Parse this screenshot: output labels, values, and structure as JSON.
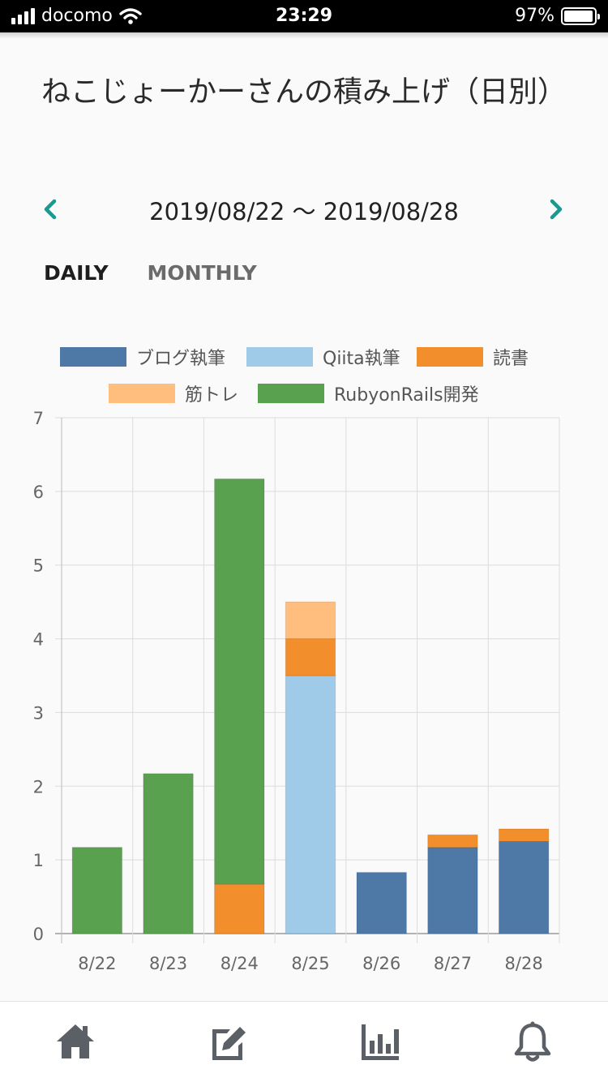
{
  "status": {
    "carrier": "docomo",
    "time": "23:29",
    "battery": "97%"
  },
  "header": {
    "title": "ねこじょーかーさんの積み上げ（日別）",
    "date_range": "2019/08/22 〜 2019/08/28"
  },
  "tabs": {
    "daily": "DAILY",
    "monthly": "MONTHLY",
    "active": "daily"
  },
  "icons": {
    "prev": "chevron-left-icon",
    "next": "chevron-right-icon",
    "home": "home-icon",
    "edit": "edit-icon",
    "stats": "bar-chart-icon",
    "notifications": "bell-icon"
  },
  "colors": {
    "accent": "#1a9a8e",
    "tabbar_icon": "#5a6066"
  },
  "chart_data": {
    "type": "bar",
    "stacked": true,
    "categories": [
      "8/22",
      "8/23",
      "8/24",
      "8/25",
      "8/26",
      "8/27",
      "8/28"
    ],
    "series": [
      {
        "name": "ブログ執筆",
        "color": "#4e79a7",
        "values": [
          0,
          0,
          0,
          0,
          0.83,
          1.17,
          1.25
        ]
      },
      {
        "name": "Qiita執筆",
        "color": "#a0cbe8",
        "values": [
          0,
          0,
          0,
          3.5,
          0,
          0,
          0
        ]
      },
      {
        "name": "読書",
        "color": "#f28e2b",
        "values": [
          0,
          0,
          0.67,
          0.5,
          0,
          0.17,
          0.17
        ]
      },
      {
        "name": "筋トレ",
        "color": "#ffbe7d",
        "values": [
          0,
          0,
          0,
          0.5,
          0,
          0,
          0
        ]
      },
      {
        "name": "RubyonRails開発",
        "color": "#59a14f",
        "values": [
          1.17,
          2.17,
          5.5,
          0,
          0,
          0,
          0
        ]
      }
    ],
    "ylim": [
      0,
      7
    ],
    "yticks": [
      "0",
      "1",
      "2",
      "3",
      "4",
      "5",
      "6",
      "7"
    ],
    "grid": true,
    "legend_position": "top"
  }
}
